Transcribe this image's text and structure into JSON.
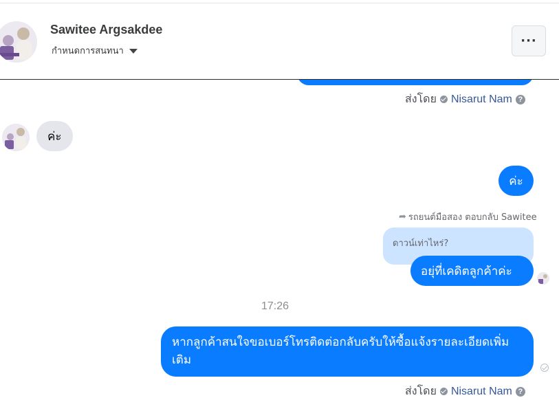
{
  "header": {
    "contact_name": "Sawitee Argsakdee",
    "subtitle": "กำหนดการสนทนา",
    "more_label": "···"
  },
  "messages": {
    "sent_by_label": "ส่งโดย",
    "sender_name": "Nisarut Nam",
    "help_glyph": "?",
    "incoming_text": "ค่ะ",
    "outgoing_short": "ค่ะ",
    "reply_meta": "รถยนต์มือสอง ตอบกลับ Sawitee",
    "quoted_text": "ดาวน์เท่าไหร่?",
    "reply_text": "อยุ่ที่เคดิตลูกค้าค่ะ",
    "timestamp": "17:26",
    "long_text": "หากลูกค้าสนใจขอเบอร์โทรติดต่อกลับครับให้ซื้อแจ้งรายละเอียดเพิ่มเติม"
  },
  "icons": {
    "verified": "check-circle-icon",
    "help": "help-icon",
    "reply": "reply-arrow-icon",
    "sent": "sent-check-icon"
  },
  "colors": {
    "accent": "#0a7cff",
    "incoming_bubble": "#e4e6eb",
    "quoted_bubble": "#cce4ff"
  }
}
